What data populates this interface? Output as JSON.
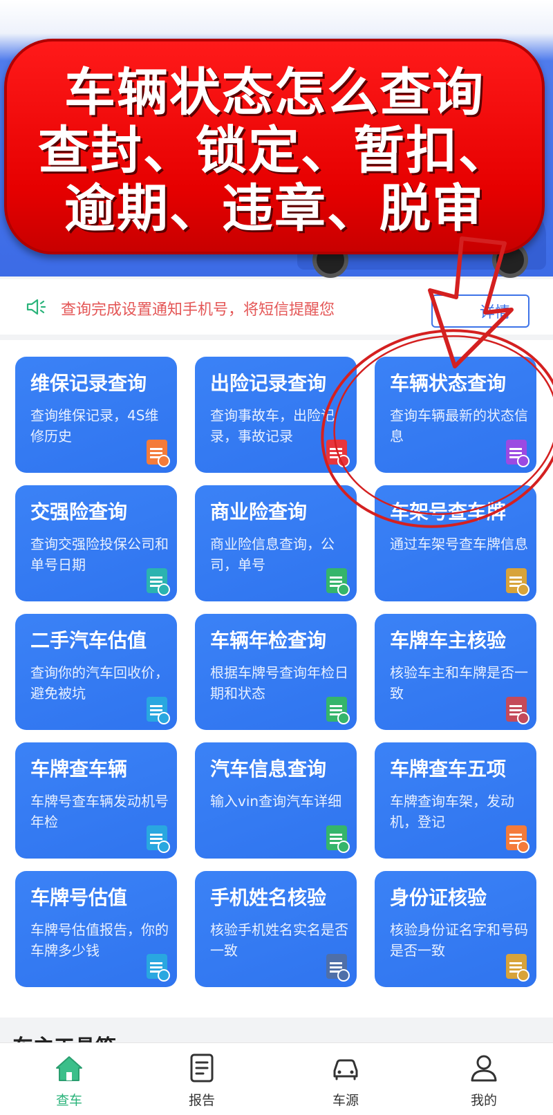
{
  "banner": {
    "line1": "车辆状态怎么查询",
    "line2": "查封、锁定、暂扣、",
    "line3": "逾期、违章、脱审"
  },
  "notice": {
    "text": "查询完成设置通知手机号，将短信提醒您",
    "detail_button": "详情"
  },
  "cards": [
    {
      "title": "维保记录查询",
      "desc": "查询维保记录，4S维修历史",
      "badge_color": "#f47b3a"
    },
    {
      "title": "出险记录查询",
      "desc": "查询事故车，出险记录，事故记录",
      "badge_color": "#e8353d"
    },
    {
      "title": "车辆状态查询",
      "desc": "查询车辆最新的状态信息",
      "badge_color": "#9b4ae2"
    },
    {
      "title": "交强险查询",
      "desc": "查询交强险投保公司和单号日期",
      "badge_color": "#2bb3b0"
    },
    {
      "title": "商业险查询",
      "desc": "商业险信息查询，公司，单号",
      "badge_color": "#35b56b"
    },
    {
      "title": "车架号查车牌",
      "desc": "通过车架号查车牌信息",
      "badge_color": "#d8a33a"
    },
    {
      "title": "二手汽车估值",
      "desc": "查询你的汽车回收价，避免被坑",
      "badge_color": "#29a7e0"
    },
    {
      "title": "车辆年检查询",
      "desc": "根据车牌号查询年检日期和状态",
      "badge_color": "#35b56b"
    },
    {
      "title": "车牌车主核验",
      "desc": "核验车主和车牌是否一致",
      "badge_color": "#c44a5a"
    },
    {
      "title": "车牌查车辆",
      "desc": "车牌号查车辆发动机号年检",
      "badge_color": "#29a7e0"
    },
    {
      "title": "汽车信息查询",
      "desc": "输入vin查询汽车详细",
      "badge_color": "#35b56b"
    },
    {
      "title": "车牌查车五项",
      "desc": "车牌查询车架，发动机，登记",
      "badge_color": "#f47b3a"
    },
    {
      "title": "车牌号估值",
      "desc": "车牌号估值报告，你的车牌多少钱",
      "badge_color": "#29a7e0"
    },
    {
      "title": "手机姓名核验",
      "desc": "核验手机姓名实名是否一致",
      "badge_color": "#4f6fa8"
    },
    {
      "title": "身份证核验",
      "desc": "核验身份证名字和号码是否一致",
      "badge_color": "#d8a33a"
    }
  ],
  "section_heading": "车主工具箱",
  "tabs": [
    {
      "label": "查车",
      "icon": "home-icon",
      "active": true
    },
    {
      "label": "报告",
      "icon": "report-icon",
      "active": false
    },
    {
      "label": "车源",
      "icon": "car-icon",
      "active": false
    },
    {
      "label": "我的",
      "icon": "user-icon",
      "active": false
    }
  ],
  "colors": {
    "card_blue": "#3b82f6",
    "banner_red": "#e60000",
    "notice_red": "#e45757",
    "active_green": "#2ab37a",
    "annotation_red": "#d42020"
  }
}
